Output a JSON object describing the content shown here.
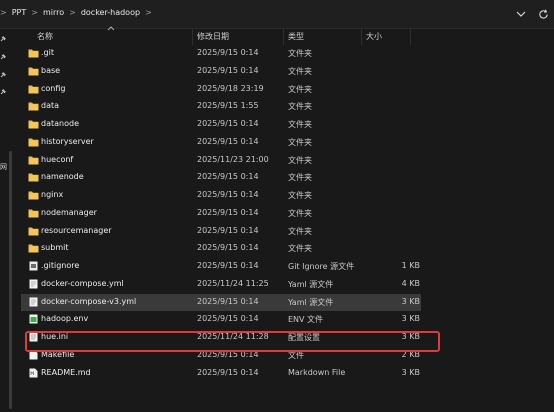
{
  "address": {
    "crumbs": [
      "PPT",
      "mirro",
      "docker-hadoop"
    ],
    "separator": ">"
  },
  "sidebar": {
    "label": "网"
  },
  "columns": {
    "name": "名称",
    "date": "修改日期",
    "type": "类型",
    "size": "大小"
  },
  "files": [
    {
      "name": ".git",
      "date": "2025/9/15 0:14",
      "type": "文件夹",
      "size": "",
      "icon": "folder-icon"
    },
    {
      "name": "base",
      "date": "2025/9/15 0:14",
      "type": "文件夹",
      "size": "",
      "icon": "folder-icon"
    },
    {
      "name": "config",
      "date": "2025/9/18 23:19",
      "type": "文件夹",
      "size": "",
      "icon": "folder-icon"
    },
    {
      "name": "data",
      "date": "2025/9/15 1:55",
      "type": "文件夹",
      "size": "",
      "icon": "folder-icon"
    },
    {
      "name": "datanode",
      "date": "2025/9/15 0:14",
      "type": "文件夹",
      "size": "",
      "icon": "folder-icon"
    },
    {
      "name": "historyserver",
      "date": "2025/9/15 0:14",
      "type": "文件夹",
      "size": "",
      "icon": "folder-icon"
    },
    {
      "name": "hueconf",
      "date": "2025/11/23 21:00",
      "type": "文件夹",
      "size": "",
      "icon": "folder-icon"
    },
    {
      "name": "namenode",
      "date": "2025/9/15 0:14",
      "type": "文件夹",
      "size": "",
      "icon": "folder-icon"
    },
    {
      "name": "nginx",
      "date": "2025/9/15 0:14",
      "type": "文件夹",
      "size": "",
      "icon": "folder-icon"
    },
    {
      "name": "nodemanager",
      "date": "2025/9/15 0:14",
      "type": "文件夹",
      "size": "",
      "icon": "folder-icon"
    },
    {
      "name": "resourcemanager",
      "date": "2025/9/15 0:14",
      "type": "文件夹",
      "size": "",
      "icon": "folder-icon"
    },
    {
      "name": "submit",
      "date": "2025/9/15 0:14",
      "type": "文件夹",
      "size": "",
      "icon": "folder-icon"
    },
    {
      "name": ".gitignore",
      "date": "2025/9/15 0:14",
      "type": "Git Ignore 源文件",
      "size": "1 KB",
      "icon": "gitignore-file-icon"
    },
    {
      "name": "docker-compose.yml",
      "date": "2025/11/24 11:25",
      "type": "Yaml 源文件",
      "size": "4 KB",
      "icon": "yaml-file-icon"
    },
    {
      "name": "docker-compose-v3.yml",
      "date": "2025/9/15 0:14",
      "type": "Yaml 源文件",
      "size": "3 KB",
      "icon": "yaml-file-icon",
      "selected": true
    },
    {
      "name": "hadoop.env",
      "date": "2025/9/15 0:14",
      "type": "ENV 文件",
      "size": "3 KB",
      "icon": "env-file-icon"
    },
    {
      "name": "hue.ini",
      "date": "2025/11/24 11:28",
      "type": "配置设置",
      "size": "3 KB",
      "icon": "ini-file-icon",
      "highlighted": true
    },
    {
      "name": "Makefile",
      "date": "2025/9/15 0:14",
      "type": "文件",
      "size": "2 KB",
      "icon": "generic-file-icon"
    },
    {
      "name": "README.md",
      "date": "2025/9/15 0:14",
      "type": "Markdown File",
      "size": "3 KB",
      "icon": "markdown-file-icon"
    }
  ]
}
